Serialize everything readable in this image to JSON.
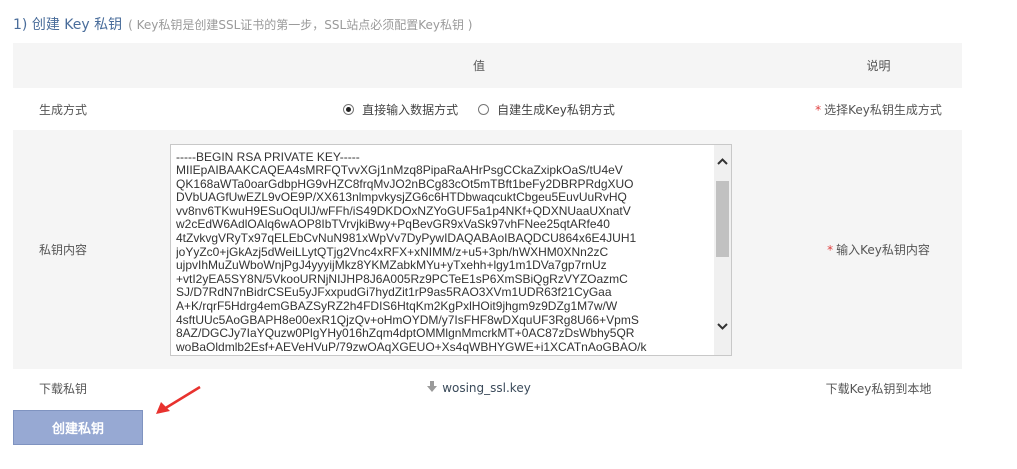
{
  "section": {
    "title": "1) 创建  Key 私钥",
    "note": "( Key私钥是创建SSL证书的第一步，SSL站点必须配置Key私钥 )"
  },
  "table": {
    "header": {
      "name": "",
      "value": "值",
      "desc": "说明"
    },
    "method": {
      "label": "生成方式",
      "options": [
        {
          "label": "直接输入数据方式",
          "checked": true
        },
        {
          "label": "自建生成Key私钥方式",
          "checked": false
        }
      ],
      "desc_required": "*",
      "desc": "选择Key私钥生成方式"
    },
    "key": {
      "label": "私钥内容",
      "content": "-----BEGIN RSA PRIVATE KEY-----\nMIIEpAIBAAKCAQEA4sMRFQTvvXGj1nMzq8PipaRaAHrPsgCCkaZxipkOaS/tU4eV\nQK168aWTa0oarGdbpHG9vHZC8frqMvJO2nBCg83cOt5mTBft1beFy2DBRPRdgXUO\nDVbUAGfUwEZL9vOE9P/XX613nlmpvkysjZG6c6HTDbwaqcuktCbgeu5EuvUuRvHQ\nvv8nv6TKwuH9ESuOqUlJ/wFFh/iS49DKDOxNZYoGUF5a1p4NKf+QDXNUaaUXnatV\nw2cEdW6AdlOAlq6wAOP8IbTVrvjkiBwy+PqBevGR9xVaSk97vhFNee25qtARfe40\n4tZvkvgVRyTx97qELEbCvNuN981xWpVv7DyPywIDAQABAoIBAQDCU864x6E4JUH1\njoYyZc0+jGkAzj5dWeiLLytQTjg2Vnc4xRFX+xNIMM/z+u5+3ph/hWXHM0XNn2zC\nujpvIhMuZuWboWnjPgJ4yyyijMkz8YKMZabkMYu+yTxehh+lgy1m1DVa7gp7rnUz\n+vtI2yEA5SY8N/5VkooURNjNIJHP8J6A005Rz9PCTeE1sP6XmSBiQgRzVYZOazmC\nSJ/D7RdN7nBidrCSEu5yJFxxpudGi7hydZit1rP9as5RAO3XVm1UDR63f21CyGaa\nA+K/rqrF5Hdrg4emGBAZSyRZ2h4FDIS6HtqKm2KgPxlHOit9jhgm9z9DZg1M7w/W\n4sftUUc5AoGBAPH8e00exR1QjzQv+oHmOYDM/y7IsFHF8wDXquUF3Rg8U66+VpmS\n8AZ/DGCJy7IaYQuzw0PlgYHy016hZqm4dptOMMlgnMmcrkMT+0AC87zDsWbhy5QR\nwoBaOldmlb2Esf+AEVeHVuP/79zwOAqXGEUO+Xs4qWBHYGWE+i1XCATnAoGBAO/k"
    },
    "download": {
      "label": "下载私钥",
      "icon": "download-arrow-icon",
      "link": "wosing_ssl.key",
      "desc": "下载Key私钥到本地"
    }
  },
  "buttons": {
    "create": "创建私钥"
  },
  "annotation": {
    "arrow_color": "#e8322e"
  }
}
